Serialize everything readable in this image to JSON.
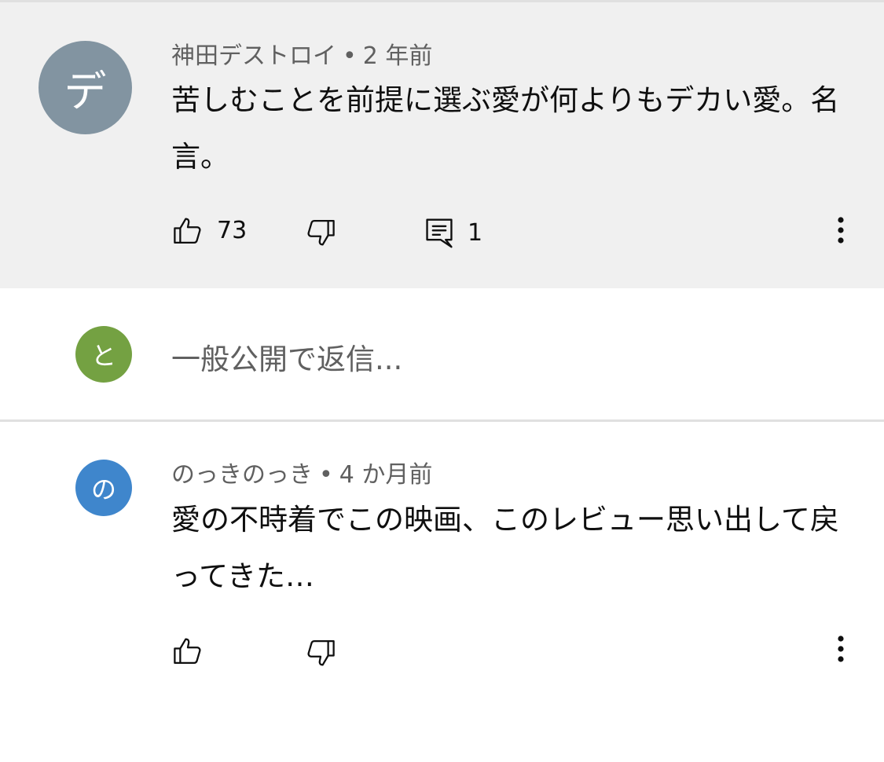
{
  "comments": [
    {
      "avatar_letter": "デ",
      "avatar_color": "#8294a1",
      "author": "神田デストロイ",
      "separator": "•",
      "time": "2 年前",
      "text": "苦しむことを前提に選ぶ愛が何よりもデカい愛。名言。",
      "likes": "73",
      "replies": "1",
      "highlighted": true
    },
    {
      "avatar_letter": "の",
      "avatar_color": "#3f86cc",
      "author": "のっきのっき",
      "separator": "•",
      "time": "4 か月前",
      "text": "愛の不時着でこの映画、このレビュー思い出して戻ってきた…",
      "likes": "",
      "highlighted": false
    }
  ],
  "reply_box": {
    "avatar_letter": "と",
    "avatar_color": "#74a142",
    "placeholder": "一般公開で返信..."
  },
  "icons": {
    "like": "thumbs-up-icon",
    "dislike": "thumbs-down-icon",
    "reply": "comment-reply-icon",
    "more": "more-vert-icon"
  },
  "colors": {
    "highlight_bg": "#f0f0f0",
    "secondary_text": "#606060",
    "divider": "#e0e0e0"
  }
}
